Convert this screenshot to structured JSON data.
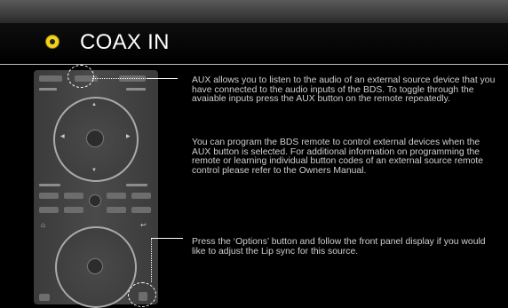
{
  "header": {
    "title": "COAX IN",
    "icon": "yellow-circle-icon",
    "icon_color": "#f2d21c"
  },
  "description": {
    "paragraph_1": "AUX allows you to listen to the audio of an external source device that you have connected to the audio inputs of the BDS. To toggle through the avaiable inputs press the  AUX button on the remote repeatedly.",
    "paragraph_2": "You can program the BDS remote to control external devices when the AUX button is selected. For additional information on programming the remote or learning individual button codes of an external source remote control please refer to the Owners Manual.",
    "paragraph_3": "Press the ‘Options’ button and follow the front panel display if you would like to adjust the Lip sync for this source."
  }
}
